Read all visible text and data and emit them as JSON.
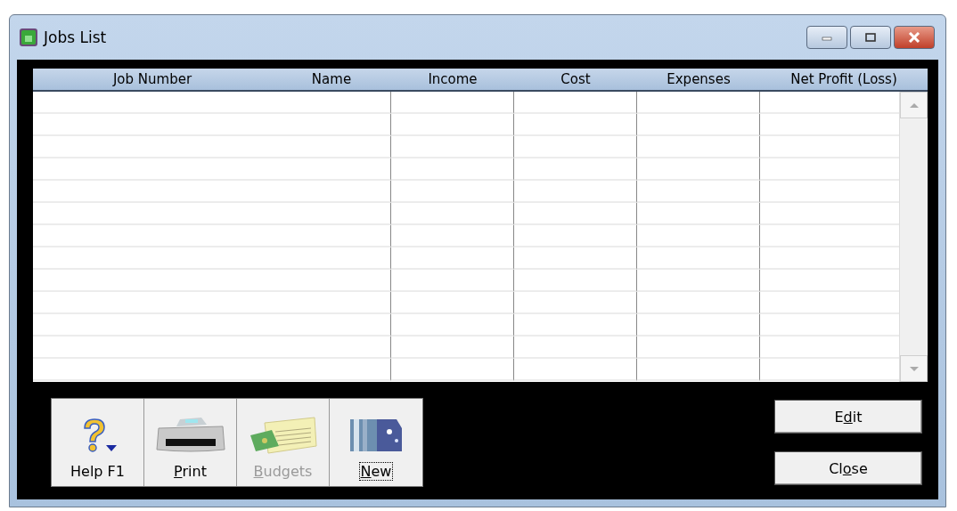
{
  "window": {
    "title": "Jobs List"
  },
  "table": {
    "columns": [
      "Job Number",
      "Name",
      "Income",
      "Cost",
      "Expenses",
      "Net Profit (Loss)"
    ]
  },
  "toolbar": [
    {
      "kind": "help",
      "pre": "Help F1",
      "disabled": false,
      "focused": false
    },
    {
      "kind": "print",
      "key": "P",
      "post": "rint",
      "disabled": false,
      "focused": false
    },
    {
      "kind": "budgets",
      "key": "B",
      "post": "udgets",
      "disabled": true,
      "focused": false
    },
    {
      "kind": "new",
      "key": "N",
      "post": "ew",
      "disabled": false,
      "focused": true
    }
  ],
  "buttons": [
    {
      "pre": "E",
      "key": "d",
      "post": "it"
    },
    {
      "pre": "Cl",
      "key": "o",
      "post": "se"
    }
  ]
}
